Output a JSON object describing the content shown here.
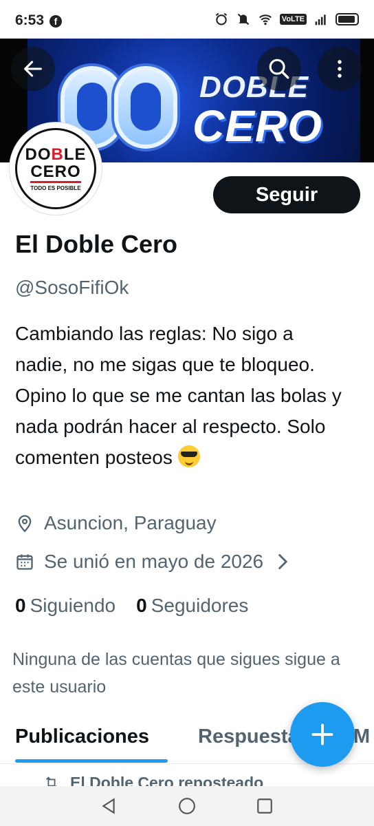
{
  "status_bar": {
    "time": "6:53",
    "facebook_badge": "f",
    "volte": "VoLTE"
  },
  "banner": {
    "line1": "DOBLE",
    "line2": "CERO"
  },
  "avatar": {
    "line1_a": "DO",
    "line1_b": "B",
    "line1_c": "LE",
    "line2": "CERO",
    "tagline": "TODO ES POSIBLE"
  },
  "profile": {
    "follow_label": "Seguir",
    "name": "El Doble Cero",
    "handle": "@SosoFifiOk",
    "bio": "Cambiando las reglas: No sigo a nadie, no me sigas que te bloqueo. Opino lo que se me cantan las bolas y nada podrán hacer al respecto. Solo comenten posteos",
    "location": "Asuncion, Paraguay",
    "joined": "Se unió en mayo de 2026",
    "following_count": "0",
    "following_label": "Siguiendo",
    "followers_count": "0",
    "followers_label": "Seguidores",
    "notice": "Ninguna de las cuentas que sigues sigue a este usuario"
  },
  "tabs": [
    {
      "label": "Publicaciones"
    },
    {
      "label": "Respuestas"
    },
    {
      "label": "M"
    }
  ],
  "repost_line": "El Doble Cero reposteado",
  "icons": {
    "back": "arrow-left-icon",
    "search": "search-icon",
    "more": "more-vertical-icon",
    "location": "location-pin-icon",
    "calendar": "calendar-icon",
    "compose": "plus-icon"
  },
  "colors": {
    "accent": "#1d9bf0",
    "text": "#0f1419",
    "secondary": "#536471",
    "banner_blue": "#0b2a8a",
    "avatar_red": "#d71e28"
  }
}
